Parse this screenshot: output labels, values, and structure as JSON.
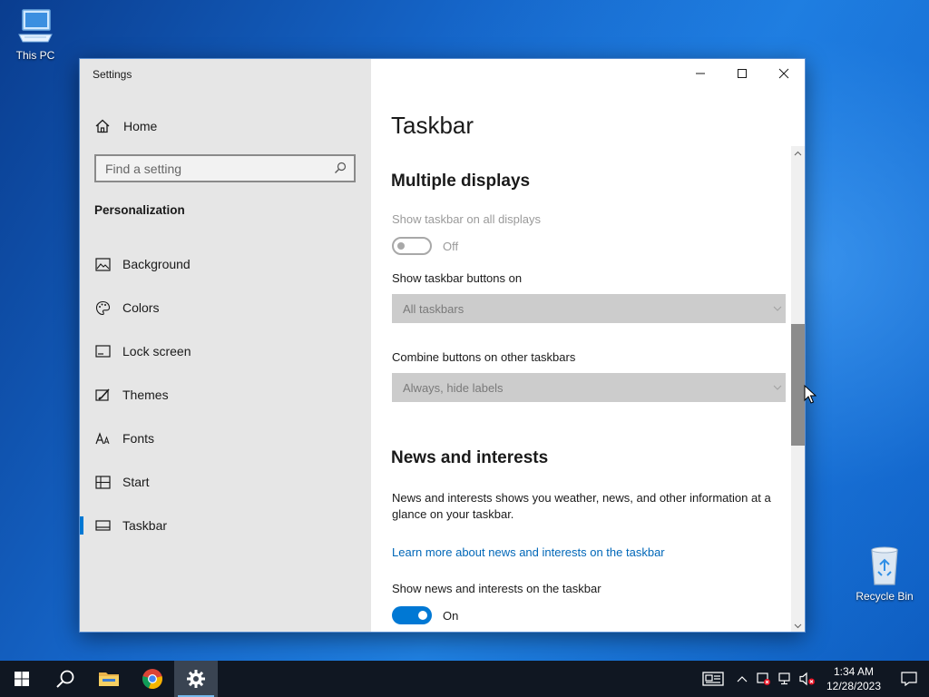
{
  "desktop": {
    "icons": [
      {
        "label": "This PC"
      },
      {
        "label": "Recycle Bin"
      }
    ]
  },
  "window": {
    "app_title": "Settings",
    "controls": [
      "minimize-icon",
      "maximize-icon",
      "close-icon"
    ]
  },
  "sidebar": {
    "home_label": "Home",
    "search_placeholder": "Find a setting",
    "section": "Personalization",
    "items": [
      {
        "label": "Background",
        "icon": "picture-icon"
      },
      {
        "label": "Colors",
        "icon": "palette-icon"
      },
      {
        "label": "Lock screen",
        "icon": "lock-screen-icon"
      },
      {
        "label": "Themes",
        "icon": "themes-icon"
      },
      {
        "label": "Fonts",
        "icon": "fonts-icon"
      },
      {
        "label": "Start",
        "icon": "start-icon"
      },
      {
        "label": "Taskbar",
        "icon": "taskbar-icon",
        "active": true
      }
    ]
  },
  "content": {
    "page_title": "Taskbar",
    "multiple_displays": {
      "heading": "Multiple displays",
      "show_all_label": "Show taskbar on all displays",
      "show_all_state": "Off",
      "buttons_on_label": "Show taskbar buttons on",
      "buttons_on_value": "All taskbars",
      "combine_label": "Combine buttons on other taskbars",
      "combine_value": "Always, hide labels"
    },
    "news": {
      "heading": "News and interests",
      "description": "News and interests shows you weather, news, and other information at a glance on your taskbar.",
      "link": "Learn more about news and interests on the taskbar",
      "show_label": "Show news and interests on the taskbar",
      "show_state": "On"
    }
  },
  "taskbar": {
    "apps": [
      "windows-start-icon",
      "search-icon",
      "file-explorer-icon",
      "chrome-icon",
      "settings-gear-icon"
    ],
    "clock_time": "1:34 AM",
    "clock_date": "12/28/2023"
  },
  "colors": {
    "accent": "#0078d4",
    "link": "#0067b8",
    "taskbar": "#101722"
  }
}
